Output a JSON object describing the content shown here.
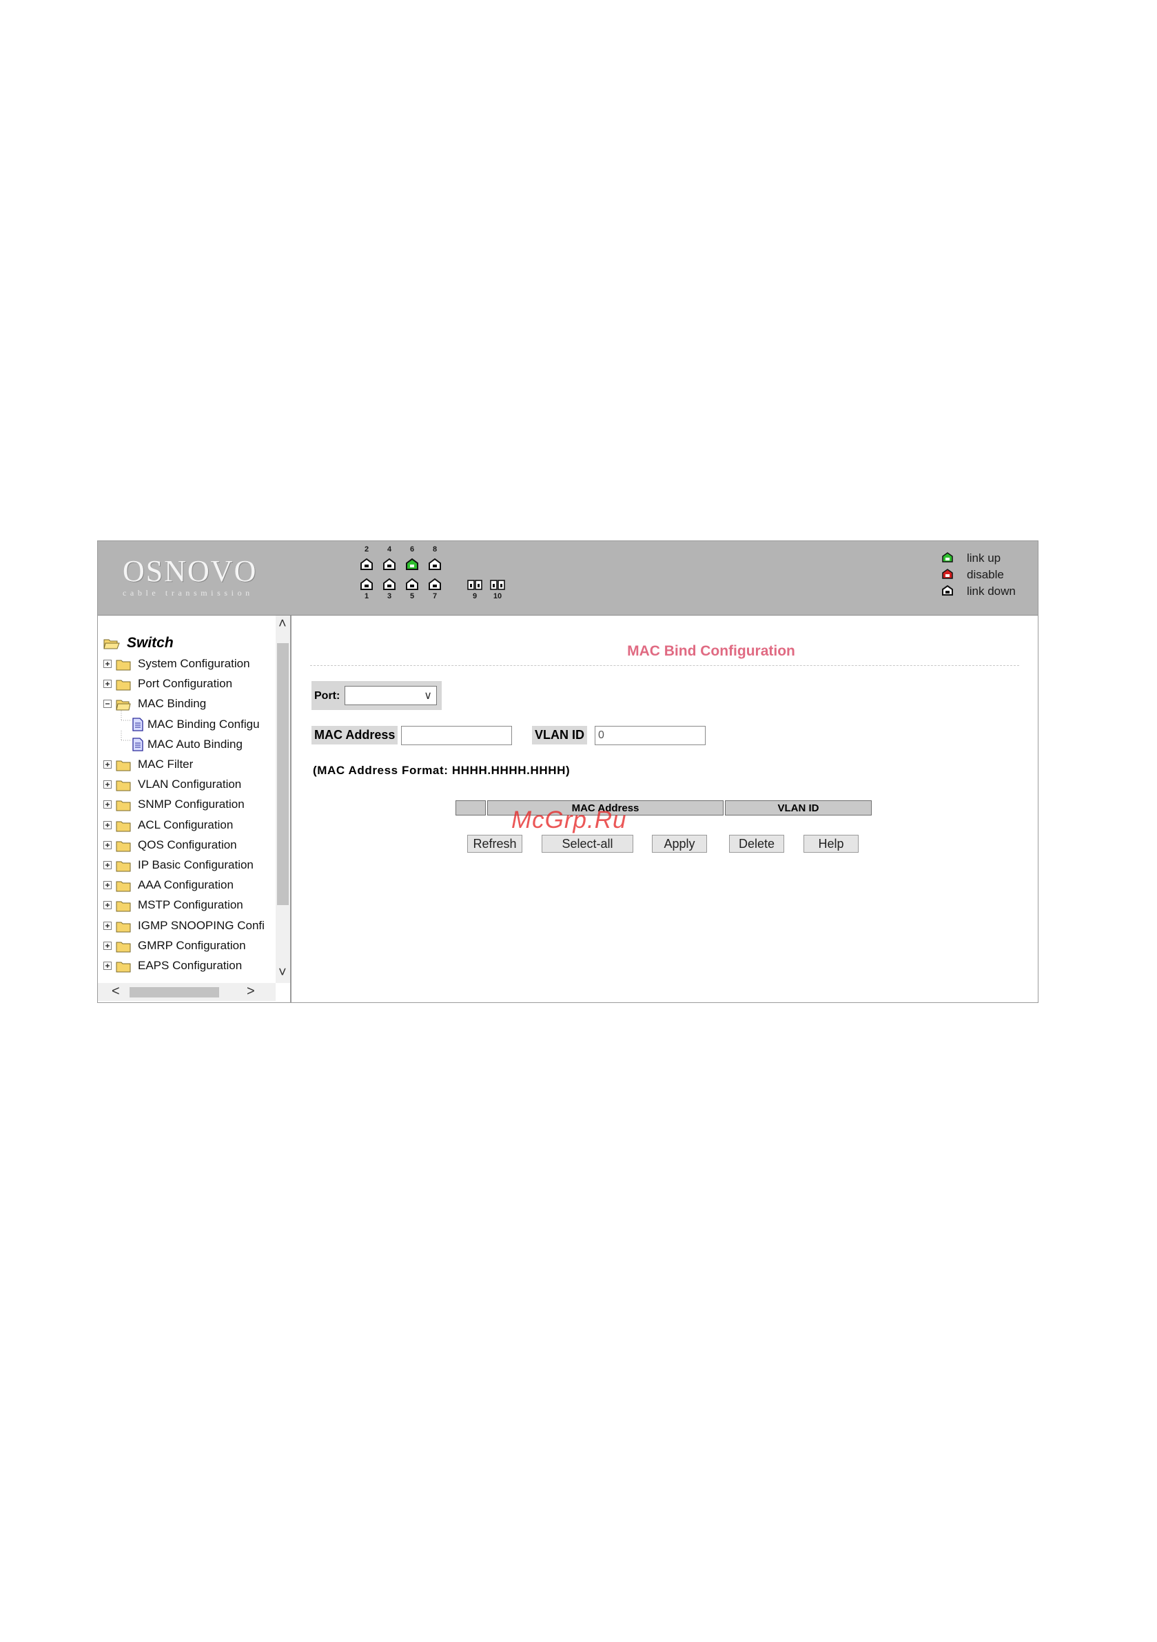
{
  "header": {
    "logo_main": "OSNOVO",
    "logo_sub": "cable transmission",
    "ports_top": [
      {
        "num": "2",
        "status": "link down"
      },
      {
        "num": "4",
        "status": "link down"
      },
      {
        "num": "6",
        "status": "link up"
      },
      {
        "num": "8",
        "status": "link down"
      }
    ],
    "ports_bottom": [
      {
        "num": "1",
        "status": "link down"
      },
      {
        "num": "3",
        "status": "link down"
      },
      {
        "num": "5",
        "status": "link down"
      },
      {
        "num": "7",
        "status": "link down"
      }
    ],
    "ports_fiber": [
      {
        "num": "9",
        "status": "link down"
      },
      {
        "num": "10",
        "status": "link down"
      }
    ],
    "legend": [
      {
        "label": "link up",
        "color": "#2fbf2f"
      },
      {
        "label": "disable",
        "color": "#d41f1f"
      },
      {
        "label": "link down",
        "color": "#1a1a1a"
      }
    ]
  },
  "sidebar": {
    "root": "Switch",
    "items": [
      {
        "label": "System Configuration",
        "expanded": false
      },
      {
        "label": "Port Configuration",
        "expanded": false
      },
      {
        "label": "MAC Binding",
        "expanded": true
      },
      {
        "label": "MAC Binding Configu",
        "child": true
      },
      {
        "label": "MAC Auto Binding",
        "child": true
      },
      {
        "label": "MAC Filter",
        "expanded": false
      },
      {
        "label": "VLAN Configuration",
        "expanded": false
      },
      {
        "label": "SNMP Configuration",
        "expanded": false
      },
      {
        "label": "ACL Configuration",
        "expanded": false
      },
      {
        "label": "QOS Configuration",
        "expanded": false
      },
      {
        "label": "IP Basic Configuration",
        "expanded": false
      },
      {
        "label": "AAA Configuration",
        "expanded": false
      },
      {
        "label": "MSTP Configuration",
        "expanded": false
      },
      {
        "label": "IGMP SNOOPING Confi",
        "expanded": false
      },
      {
        "label": "GMRP Configuration",
        "expanded": false
      },
      {
        "label": "EAPS Configuration",
        "expanded": false
      }
    ]
  },
  "main": {
    "title": "MAC Bind Configuration",
    "port_label": "Port:",
    "port_value": "",
    "mac_label": "MAC Address",
    "mac_value": "",
    "vlan_label": "VLAN ID",
    "vlan_value": "0",
    "format_note": "(MAC Address Format: HHHH.HHHH.HHHH)",
    "table_headers": [
      "",
      "MAC Address",
      "VLAN ID"
    ],
    "buttons": {
      "refresh": "Refresh",
      "select_all": "Select-all",
      "apply": "Apply",
      "delete": "Delete",
      "help": "Help"
    }
  },
  "watermark": "McGrp.Ru"
}
